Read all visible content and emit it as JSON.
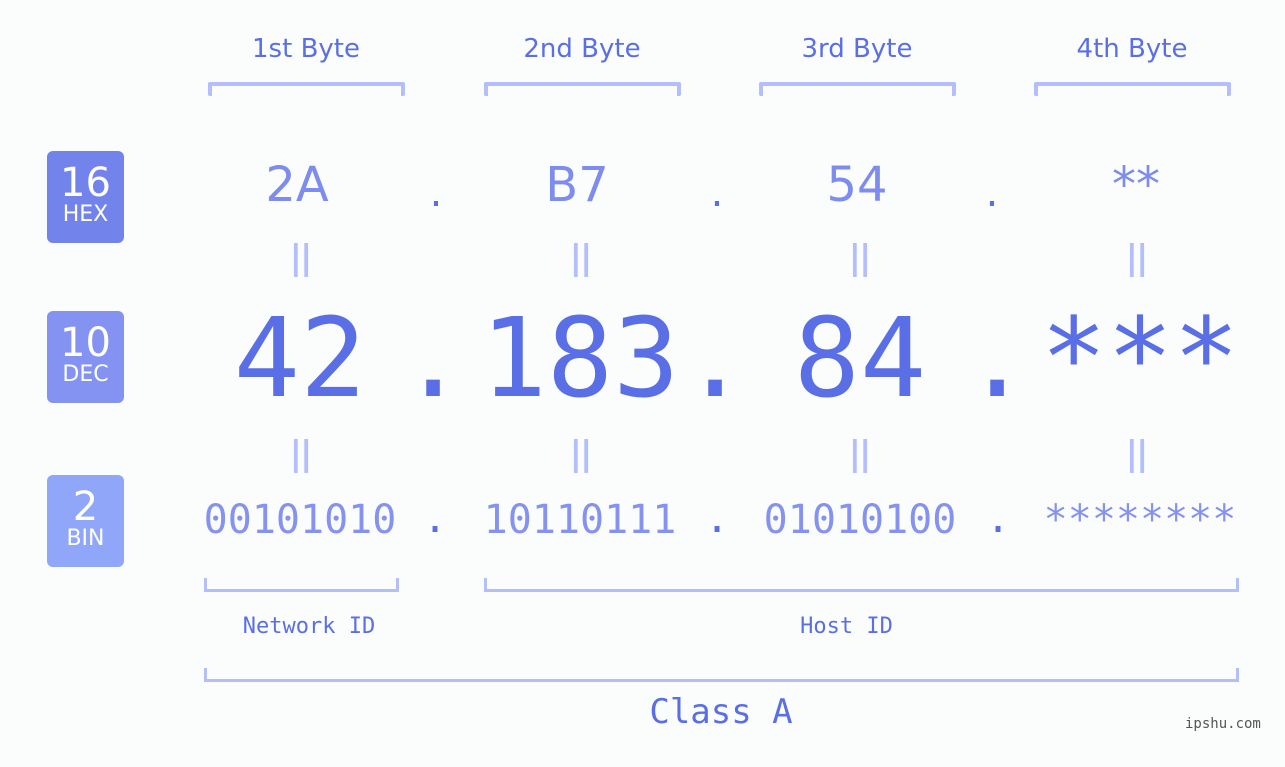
{
  "byte_headers": [
    "1st Byte",
    "2nd Byte",
    "3rd Byte",
    "4th Byte"
  ],
  "badges": [
    {
      "number": "16",
      "label": "HEX",
      "color": "#7383ec"
    },
    {
      "number": "10",
      "label": "DEC",
      "color": "#8493f1"
    },
    {
      "number": "2",
      "label": "BIN",
      "color": "#8fa6f9"
    }
  ],
  "hex": [
    "2A",
    "B7",
    "54",
    "**"
  ],
  "dec": [
    "42",
    "183",
    "84",
    "***"
  ],
  "bin": [
    "00101010",
    "10110111",
    "01010100",
    "********"
  ],
  "separator": ".",
  "equals": "||",
  "network_id_label": "Network ID",
  "host_id_label": "Host ID",
  "class_label": "Class A",
  "watermark": "ipshu.com",
  "colors": {
    "accent": "#5a6fe6",
    "light": "#b3befa",
    "mid": "#8592f0"
  }
}
